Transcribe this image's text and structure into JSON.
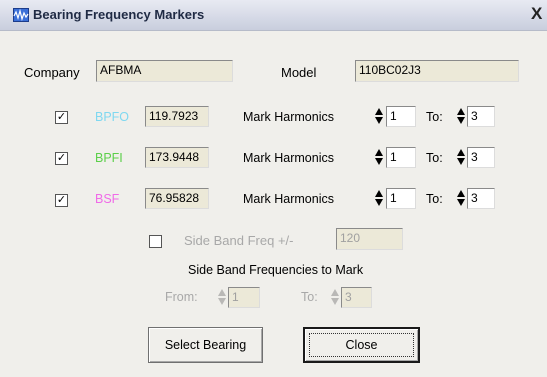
{
  "window": {
    "title": "Bearing Frequency Markers",
    "close_glyph": "X"
  },
  "company": {
    "label": "Company",
    "value": "AFBMA"
  },
  "model": {
    "label": "Model",
    "value": "110BC02J3"
  },
  "rows": [
    {
      "checked": true,
      "checkmark": "✓",
      "name": "BPFO",
      "color": "#7fd8f0",
      "value": "119.7923",
      "harmonics_label": "Mark Harmonics",
      "from": "1",
      "to_label": "To:",
      "to": "3"
    },
    {
      "checked": true,
      "checkmark": "✓",
      "name": "BPFI",
      "color": "#5ccf4a",
      "value": "173.9448",
      "harmonics_label": "Mark Harmonics",
      "from": "1",
      "to_label": "To:",
      "to": "3"
    },
    {
      "checked": true,
      "checkmark": "✓",
      "name": "BSF",
      "color": "#f06ae8",
      "value": "76.95828",
      "harmonics_label": "Mark Harmonics",
      "from": "1",
      "to_label": "To:",
      "to": "3"
    }
  ],
  "sideband": {
    "checked": false,
    "label": "Side Band Freq +/-",
    "value": "120",
    "mark_label": "Side Band Frequencies to Mark",
    "from_label": "From:",
    "from": "1",
    "to_label": "To:",
    "to": "3"
  },
  "buttons": {
    "select_bearing": "Select Bearing",
    "close": "Close"
  },
  "icons": {
    "title": "waveform-app-icon",
    "close": "close-icon",
    "spinner": "spinner-arrows-icon"
  }
}
